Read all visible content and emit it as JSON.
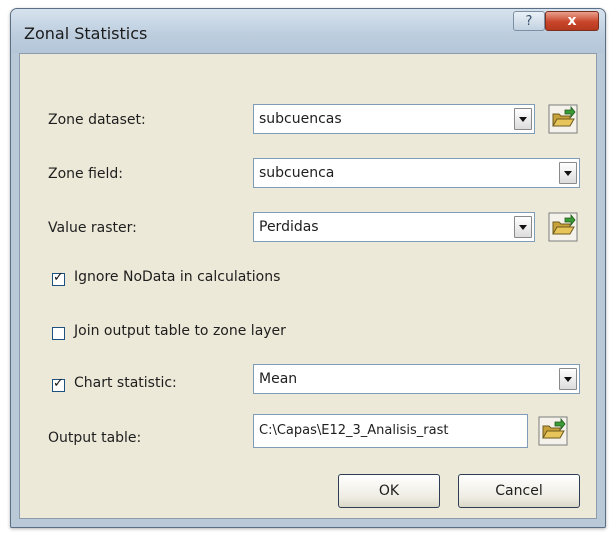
{
  "dialog": {
    "title": "Zonal Statistics",
    "help_label": "?",
    "close_label": "x"
  },
  "form": {
    "zone_dataset": {
      "label": "Zone dataset:",
      "value": "subcuencas"
    },
    "zone_field": {
      "label": "Zone field:",
      "value": "subcuenca"
    },
    "value_raster": {
      "label": "Value raster:",
      "value": "Perdidas"
    },
    "ignore_nodata": {
      "label": "Ignore NoData in calculations",
      "checked": true
    },
    "join_output": {
      "label": "Join output table to zone layer",
      "checked": false
    },
    "chart_statistic": {
      "label": "Chart statistic:",
      "checked": true,
      "value": "Mean"
    },
    "output_table": {
      "label": "Output table:",
      "value": "C:\\Capas\\E12_3_Analisis_rast"
    }
  },
  "buttons": {
    "ok": "OK",
    "cancel": "Cancel"
  },
  "icons": {
    "browse": "open-folder-icon",
    "dropdown": "chevron-down-icon"
  }
}
